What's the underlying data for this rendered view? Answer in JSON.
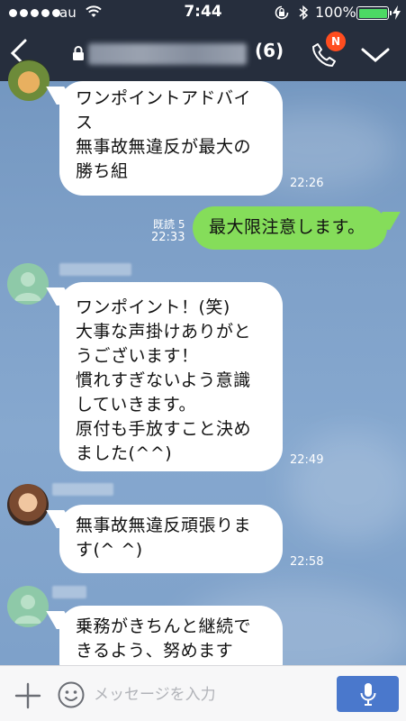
{
  "status_bar": {
    "carrier": "au",
    "time": "7:44",
    "battery": "100%"
  },
  "header": {
    "member_count": "(6)",
    "notification_badge": "N",
    "icons": [
      "back-chevron-icon",
      "lock-icon",
      "phone-icon",
      "chevron-down-icon"
    ]
  },
  "messages": [
    {
      "direction": "in",
      "lines": [
        "ワンポイントアドバイ",
        "ス",
        "無事故無違反が最大の",
        "勝ち組"
      ],
      "time": "22:26"
    },
    {
      "direction": "out",
      "read": "既読 5",
      "lines": [
        "最大限注意します。"
      ],
      "time": "22:33"
    },
    {
      "direction": "in",
      "lines": [
        "ワンポイント！(笑)",
        "大事な声掛けありがと",
        "うございます！",
        "慣れすぎないよう意識",
        "していきます。",
        "原付も手放すこと決め",
        "ました(^^)"
      ],
      "time": "22:49"
    },
    {
      "direction": "in",
      "lines": [
        "無事故無違反頑張りま",
        "す(^ ^)"
      ],
      "time": "22:58"
    },
    {
      "direction": "in",
      "lines": [
        "乗務がきちんと継続で",
        "きるよう、努めます"
      ],
      "time": ""
    }
  ],
  "input_bar": {
    "placeholder": "メッセージを入力",
    "value": ""
  },
  "colors": {
    "header_bg": "#262e3d",
    "chat_bg": "#7ea0c8",
    "outgoing_bubble": "#85dd5a",
    "mic_button": "#4a78cc",
    "badge": "#ff4d1f",
    "battery_fill": "#4cd964"
  }
}
